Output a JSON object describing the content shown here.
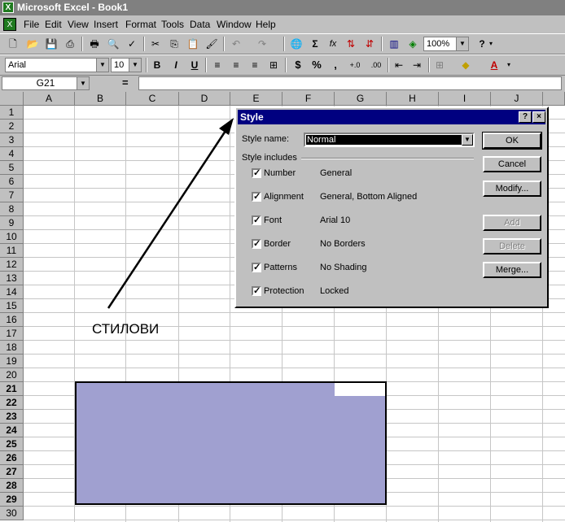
{
  "window": {
    "title": "Microsoft Excel - Book1",
    "app_icon": "excel-icon"
  },
  "menu": {
    "items": [
      "File",
      "Edit",
      "View",
      "Insert",
      "Format",
      "Tools",
      "Data",
      "Window",
      "Help"
    ]
  },
  "toolbar_standard": {
    "zoom": "100%",
    "icons": [
      "new",
      "open",
      "save",
      "print-preview",
      "print",
      "spelling",
      "cut",
      "copy",
      "paste",
      "format-painter",
      "undo",
      "redo",
      "hyperlink",
      "autosum",
      "paste-function",
      "sort-ascending",
      "sort-descending",
      "chart-wizard",
      "drawing",
      "help"
    ],
    "autosum_label": "Σ",
    "function_label": "fx"
  },
  "toolbar_formatting": {
    "font": "Arial",
    "size": "10",
    "bold": "B",
    "italic": "I",
    "underline": "U",
    "currency": "$",
    "percent": "%",
    "comma": ",",
    "inc_decimal": "+.0",
    "dec_decimal": ".00"
  },
  "formula_bar": {
    "name_box": "G21",
    "equals": "="
  },
  "sheet": {
    "columns": [
      "A",
      "B",
      "C",
      "D",
      "E",
      "F",
      "G",
      "H",
      "I",
      "J"
    ],
    "rows": [
      "1",
      "2",
      "3",
      "4",
      "5",
      "6",
      "7",
      "8",
      "9",
      "10",
      "11",
      "12",
      "13",
      "14",
      "15",
      "16",
      "17",
      "18",
      "19",
      "20",
      "21",
      "22",
      "23",
      "24",
      "25",
      "26",
      "27",
      "28",
      "29",
      "30"
    ],
    "annotation": "СТИЛОВИ",
    "selection_color": "#a0a0d0"
  },
  "dialog": {
    "title": "Style",
    "help_btn": "?",
    "close_btn": "×",
    "style_name_label": "Style name:",
    "style_name_value": "Normal",
    "includes_label": "Style includes",
    "items": [
      {
        "label": "Number",
        "value": "General",
        "checked": true
      },
      {
        "label": "Alignment",
        "value": "General, Bottom Aligned",
        "checked": true
      },
      {
        "label": "Font",
        "value": "Arial 10",
        "checked": true
      },
      {
        "label": "Border",
        "value": "No Borders",
        "checked": true
      },
      {
        "label": "Patterns",
        "value": "No Shading",
        "checked": true
      },
      {
        "label": "Protection",
        "value": "Locked",
        "checked": true
      }
    ],
    "buttons": [
      {
        "label": "OK",
        "enabled": true
      },
      {
        "label": "Cancel",
        "enabled": true
      },
      {
        "label": "Modify...",
        "enabled": true
      },
      {
        "label": "Add",
        "enabled": false
      },
      {
        "label": "Delete",
        "enabled": false
      },
      {
        "label": "Merge...",
        "enabled": true
      }
    ]
  }
}
